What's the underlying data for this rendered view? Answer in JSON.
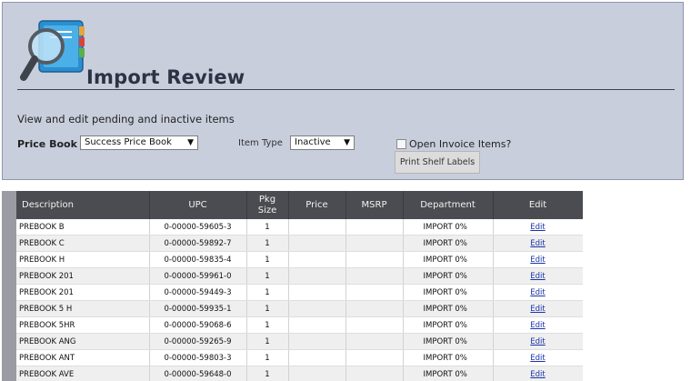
{
  "header": {
    "title": "Import Review",
    "subtitle": "View and edit pending and inactive items"
  },
  "filters": {
    "price_book_label": "Price Book",
    "price_book_value": "Success Price Book",
    "item_type_label": "Item Type",
    "item_type_value": "Inactive",
    "open_invoice_label": "Open Invoice Items?",
    "open_invoice_checked": false,
    "print_button": "Print Shelf Labels"
  },
  "table": {
    "columns": [
      "Description",
      "UPC",
      "Pkg Size",
      "Price",
      "MSRP",
      "Department",
      "Edit"
    ],
    "rows": [
      {
        "description": "PREBOOK B",
        "upc": "0-00000-59605-3",
        "pkg": "1",
        "price": "",
        "msrp": "",
        "department": "IMPORT 0%",
        "edit": "Edit"
      },
      {
        "description": "PREBOOK C",
        "upc": "0-00000-59892-7",
        "pkg": "1",
        "price": "",
        "msrp": "",
        "department": "IMPORT 0%",
        "edit": "Edit"
      },
      {
        "description": "PREBOOK H",
        "upc": "0-00000-59835-4",
        "pkg": "1",
        "price": "",
        "msrp": "",
        "department": "IMPORT 0%",
        "edit": "Edit"
      },
      {
        "description": "PREBOOK 201",
        "upc": "0-00000-59961-0",
        "pkg": "1",
        "price": "",
        "msrp": "",
        "department": "IMPORT 0%",
        "edit": "Edit"
      },
      {
        "description": "PREBOOK 201",
        "upc": "0-00000-59449-3",
        "pkg": "1",
        "price": "",
        "msrp": "",
        "department": "IMPORT 0%",
        "edit": "Edit"
      },
      {
        "description": "PREBOOK 5 H",
        "upc": "0-00000-59935-1",
        "pkg": "1",
        "price": "",
        "msrp": "",
        "department": "IMPORT 0%",
        "edit": "Edit"
      },
      {
        "description": "PREBOOK 5HR",
        "upc": "0-00000-59068-6",
        "pkg": "1",
        "price": "",
        "msrp": "",
        "department": "IMPORT 0%",
        "edit": "Edit"
      },
      {
        "description": "PREBOOK ANG",
        "upc": "0-00000-59265-9",
        "pkg": "1",
        "price": "",
        "msrp": "",
        "department": "IMPORT 0%",
        "edit": "Edit"
      },
      {
        "description": "PREBOOK ANT",
        "upc": "0-00000-59803-3",
        "pkg": "1",
        "price": "",
        "msrp": "",
        "department": "IMPORT 0%",
        "edit": "Edit"
      },
      {
        "description": "PREBOOK AVE",
        "upc": "0-00000-59648-0",
        "pkg": "1",
        "price": "",
        "msrp": "",
        "department": "IMPORT 0%",
        "edit": "Edit"
      }
    ]
  },
  "icons": {
    "logo": "magnifier-notebook-icon",
    "dropdown": "caret-down-icon"
  }
}
